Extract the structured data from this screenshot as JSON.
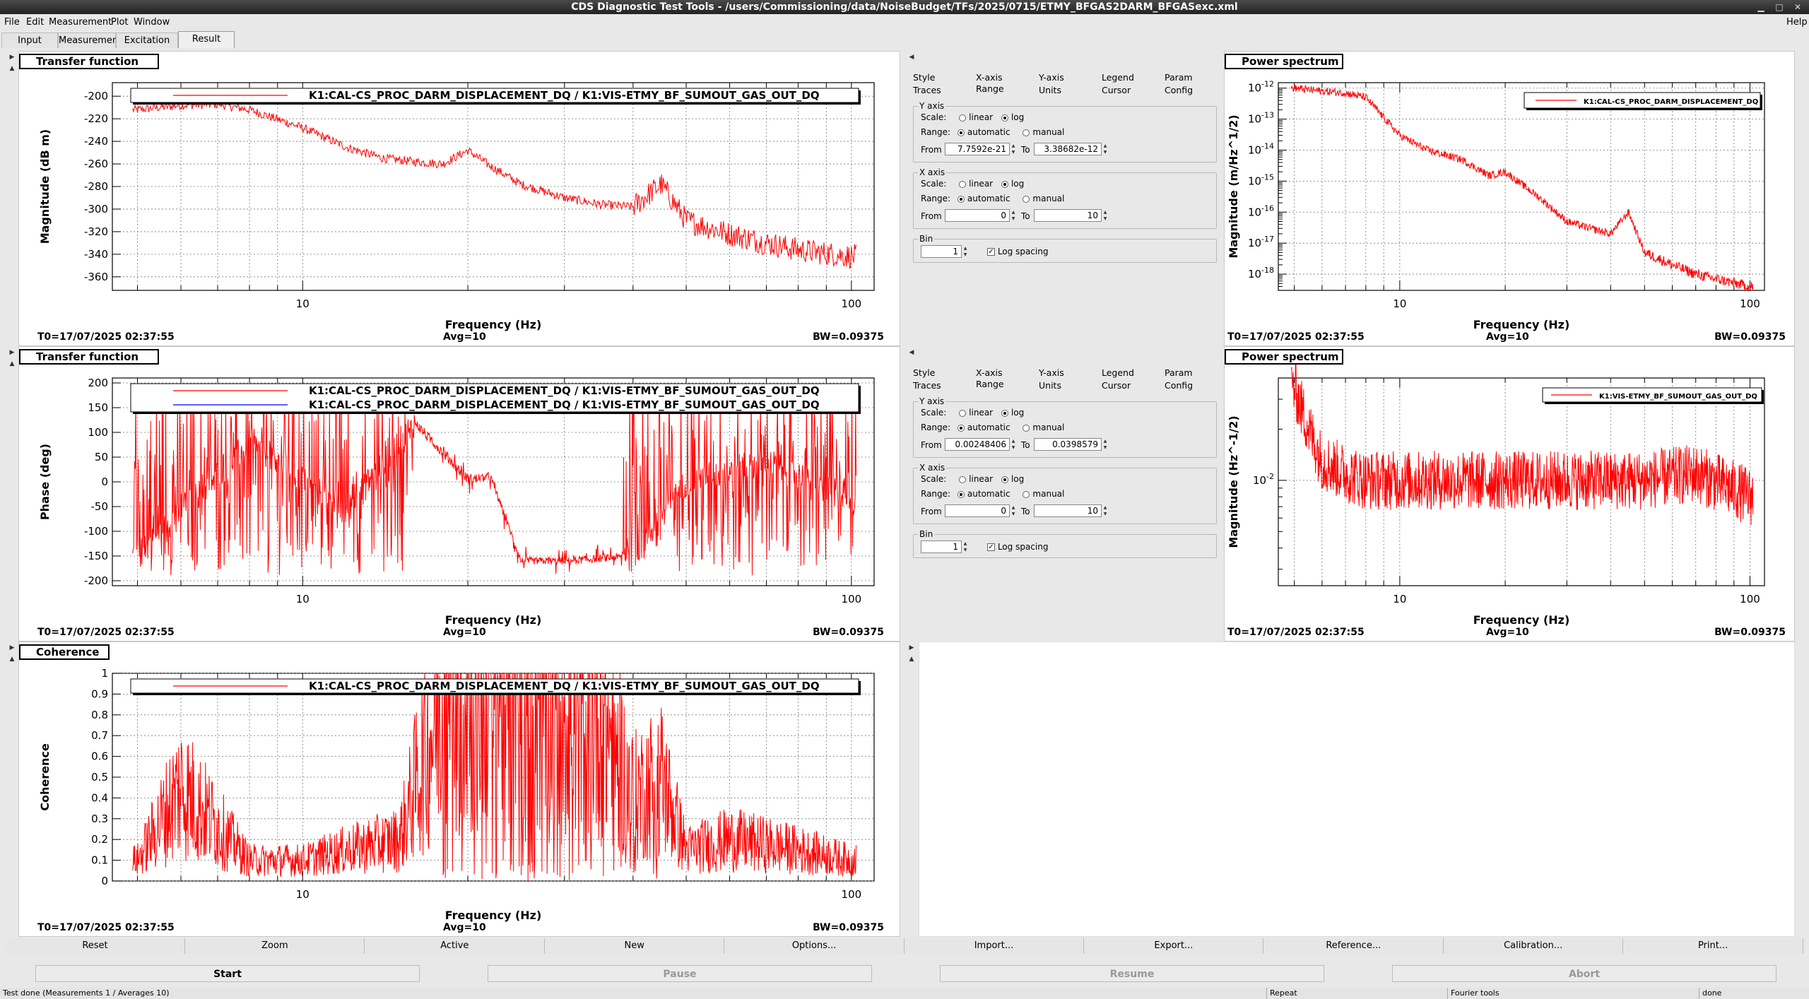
{
  "window": {
    "title": "CDS Diagnostic Test Tools - /users/Commissioning/data/NoiseBudget/TFs/2025/0715/ETMY_BFGAS2DARM_BFGASexc.xml",
    "min_glyph": "▁",
    "max_glyph": "□",
    "close_glyph": "✕"
  },
  "menu": {
    "file": "File",
    "edit": "Edit",
    "measurement": "Measurement",
    "plot": "Plot",
    "window": "Window",
    "help": "Help"
  },
  "tabs": {
    "input": "Input",
    "measurement": "Measurement",
    "excitation": "Excitation",
    "result": "Result"
  },
  "footer": {
    "t0": "T0=17/07/2025 02:37:55",
    "avg": "Avg=10",
    "bw": "BW=0.09375"
  },
  "plots": {
    "tf_mag": {
      "title": "Transfer function",
      "legend": "K1:CAL-CS_PROC_DARM_DISPLACEMENT_DQ / K1:VIS-ETMY_BF_SUMOUT_GAS_OUT_DQ",
      "ylabel": "Magnitude (dB m)",
      "xlabel": "Frequency (Hz)"
    },
    "tf_phase": {
      "title": "Transfer function",
      "legend": "K1:CAL-CS_PROC_DARM_DISPLACEMENT_DQ / K1:VIS-ETMY_BF_SUMOUT_GAS_OUT_DQ",
      "legend2": "K1:CAL-CS_PROC_DARM_DISPLACEMENT_DQ / K1:VIS-ETMY_BF_SUMOUT_GAS_OUT_DQ",
      "ylabel": "Phase (deg)",
      "xlabel": "Frequency (Hz)"
    },
    "coh": {
      "title": "Coherence",
      "legend": "K1:CAL-CS_PROC_DARM_DISPLACEMENT_DQ / K1:VIS-ETMY_BF_SUMOUT_GAS_OUT_DQ",
      "ylabel": "Coherence",
      "xlabel": "Frequency (Hz)"
    },
    "ps1": {
      "title": "Power spectrum",
      "legend": "K1:CAL-CS_PROC_DARM_DISPLACEMENT_DQ",
      "ylabel": "Magnitude (m/Hz^1/2)",
      "xlabel": "Frequency (Hz)"
    },
    "ps2": {
      "title": "Power spectrum",
      "legend": "K1:VIS-ETMY_BF_SUMOUT_GAS_OUT_DQ",
      "ylabel": "Magnitude (Hz^-1/2)",
      "xlabel": "Frequency (Hz)"
    }
  },
  "options": {
    "tabs_row1": [
      "Style",
      "X-axis",
      "Y-axis",
      "Legend",
      "Param"
    ],
    "tabs_row2": [
      "Traces",
      "Range",
      "Units",
      "Cursor",
      "Config"
    ],
    "yaxis": "Y axis",
    "xaxis": "X axis",
    "bin": "Bin",
    "scale": "Scale:",
    "linear": "linear",
    "log": "log",
    "range": "Range:",
    "automatic": "automatic",
    "manual": "manual",
    "from": "From",
    "to": "To",
    "logspacing": "Log spacing",
    "top": {
      "yfrom": "7.7592e-21",
      "yto": "3.38682e-12",
      "xfrom": "0",
      "xto": "10",
      "bin": "1"
    },
    "bottom": {
      "yfrom": "0.00248406",
      "yto": "0.0398579",
      "xfrom": "0",
      "xto": "10",
      "bin": "1"
    }
  },
  "buttons": {
    "reset": "Reset",
    "zoom": "Zoom",
    "active": "Active",
    "new": "New",
    "options": "Options...",
    "import": "Import...",
    "export": "Export...",
    "reference": "Reference...",
    "calibration": "Calibration...",
    "print": "Print..."
  },
  "controls": {
    "start": "Start",
    "pause": "Pause",
    "resume": "Resume",
    "abort": "Abort"
  },
  "status": {
    "main": "Test done (Measurements 1 / Averages 10)",
    "repeat": "Repeat",
    "fourier": "Fourier tools",
    "done": "done"
  },
  "chart_data": [
    {
      "type": "line",
      "title": "Transfer function",
      "xlabel": "Frequency (Hz)",
      "ylabel": "Magnitude (dB m)",
      "xscale": "log",
      "xlim": [
        4.5,
        110
      ],
      "ylim": [
        -372,
        -188
      ],
      "yticks": [
        -200,
        -220,
        -240,
        -260,
        -280,
        -300,
        -320,
        -340,
        -360
      ],
      "xticks": [
        10,
        100
      ],
      "grid": true,
      "legend": "top",
      "series": [
        {
          "name": "K1:CAL-CS_PROC_DARM_DISPLACEMENT_DQ / K1:VIS-ETMY_BF_SUMOUT_GAS_OUT_DQ",
          "color": "#ff0000",
          "x": [
            5,
            6,
            7,
            8,
            10,
            12,
            14,
            16,
            18,
            20,
            22,
            25,
            30,
            35,
            40,
            45,
            50,
            60,
            70,
            80,
            100
          ],
          "y": [
            -212,
            -208,
            -207,
            -212,
            -228,
            -245,
            -255,
            -258,
            -260,
            -248,
            -262,
            -278,
            -290,
            -296,
            -298,
            -278,
            -310,
            -322,
            -330,
            -336,
            -342
          ]
        }
      ]
    },
    {
      "type": "line",
      "title": "Transfer function",
      "xlabel": "Frequency (Hz)",
      "ylabel": "Phase (deg)",
      "xscale": "log",
      "xlim": [
        4.5,
        110
      ],
      "ylim": [
        -210,
        210
      ],
      "yticks": [
        200,
        150,
        100,
        50,
        0,
        -50,
        -100,
        -150,
        -200
      ],
      "xticks": [
        10,
        100
      ],
      "grid": true,
      "legend": "top",
      "series": [
        {
          "name": "K1:CAL-CS_PROC_DARM_DISPLACEMENT_DQ / K1:VIS-ETMY_BF_SUMOUT_GAS_OUT_DQ",
          "color": "#ff0000",
          "x": [
            5,
            8,
            12,
            16,
            20,
            22,
            25,
            30,
            35,
            40,
            50,
            70,
            100
          ],
          "y": [
            -150,
            80,
            -60,
            120,
            5,
            10,
            -160,
            -160,
            -155,
            -150,
            0,
            40,
            -30
          ]
        }
      ]
    },
    {
      "type": "line",
      "title": "Coherence",
      "xlabel": "Frequency (Hz)",
      "ylabel": "Coherence",
      "xscale": "log",
      "xlim": [
        4.5,
        110
      ],
      "ylim": [
        0,
        1
      ],
      "yticks": [
        0,
        0.1,
        0.2,
        0.3,
        0.4,
        0.5,
        0.6,
        0.7,
        0.8,
        0.9,
        1
      ],
      "xticks": [
        10,
        100
      ],
      "grid": true,
      "legend": "top",
      "series": [
        {
          "name": "K1:CAL-CS_PROC_DARM_DISPLACEMENT_DQ / K1:VIS-ETMY_BF_SUMOUT_GAS_OUT_DQ",
          "color": "#ff0000",
          "x": [
            5,
            6,
            8,
            10,
            12,
            15,
            18,
            20,
            25,
            30,
            35,
            40,
            45,
            50,
            60,
            80,
            100
          ],
          "y": [
            0.1,
            0.45,
            0.1,
            0.1,
            0.15,
            0.2,
            0.9,
            0.95,
            0.9,
            0.85,
            0.8,
            0.4,
            0.5,
            0.15,
            0.2,
            0.15,
            0.1
          ]
        }
      ]
    },
    {
      "type": "line",
      "title": "Power spectrum",
      "xlabel": "Frequency (Hz)",
      "ylabel": "Magnitude (m/Hz^1/2)",
      "xscale": "log",
      "yscale": "log",
      "xlim": [
        4.5,
        110
      ],
      "ylim": [
        3e-19,
        1.5e-12
      ],
      "xticks": [
        10,
        100
      ],
      "grid": true,
      "legend": "top-right",
      "series": [
        {
          "name": "K1:CAL-CS_PROC_DARM_DISPLACEMENT_DQ",
          "color": "#ff0000",
          "x": [
            5,
            6,
            7,
            8,
            10,
            12,
            15,
            18,
            20,
            25,
            30,
            35,
            40,
            45,
            50,
            60,
            70,
            80,
            100
          ],
          "y": [
            1e-12,
            8e-13,
            7e-13,
            5e-13,
            3e-14,
            1e-14,
            5e-15,
            1.5e-15,
            2e-15,
            3e-16,
            5e-17,
            3e-17,
            2e-17,
            1e-16,
            5e-18,
            2e-18,
            1e-18,
            7e-19,
            4e-19
          ]
        }
      ]
    },
    {
      "type": "line",
      "title": "Power spectrum",
      "xlabel": "Frequency (Hz)",
      "ylabel": "Magnitude (Hz^-1/2)",
      "xscale": "log",
      "yscale": "log",
      "xlim": [
        4.5,
        110
      ],
      "ylim": [
        0.0024,
        0.04
      ],
      "xticks": [
        10,
        100
      ],
      "grid": true,
      "legend": "top-right",
      "series": [
        {
          "name": "K1:VIS-ETMY_BF_SUMOUT_GAS_OUT_DQ",
          "color": "#ff0000",
          "x": [
            5,
            5.5,
            6,
            7,
            8,
            10,
            15,
            20,
            30,
            50,
            70,
            100
          ],
          "y": [
            0.035,
            0.02,
            0.013,
            0.011,
            0.01,
            0.01,
            0.01,
            0.01,
            0.01,
            0.01,
            0.011,
            0.008
          ]
        }
      ]
    }
  ]
}
